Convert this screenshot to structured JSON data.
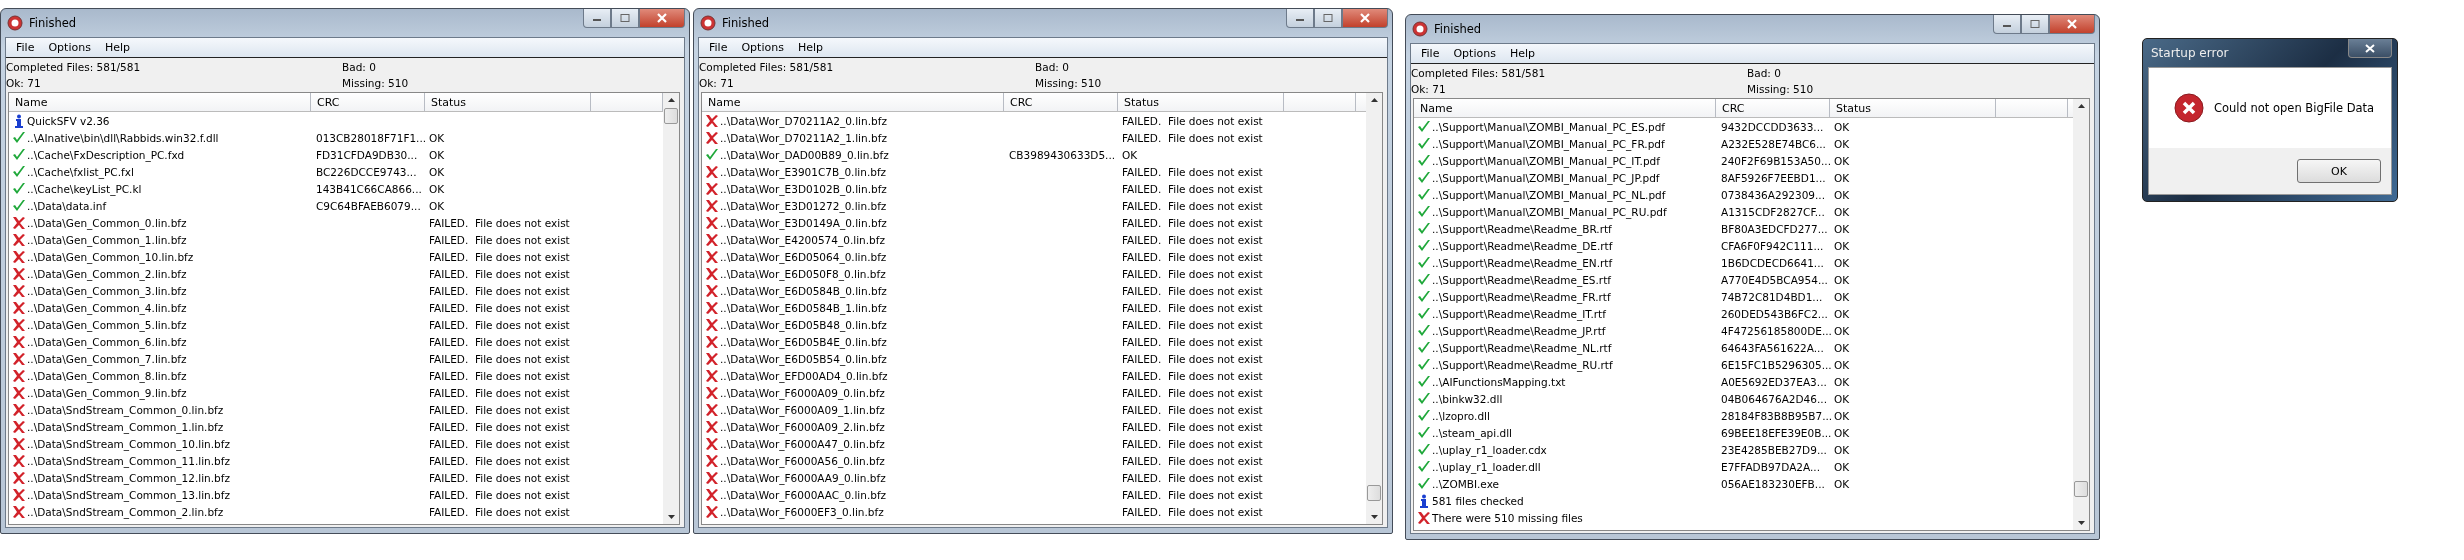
{
  "windows": [
    {
      "title": "Finished",
      "menu": [
        "File",
        "Options",
        "Help"
      ],
      "stats": {
        "completed": "Completed Files: 581/581",
        "bad": "Bad: 0",
        "ok": "Ok: 71",
        "missing": "Missing: 510"
      },
      "columns": [
        "Name",
        "CRC",
        "Status"
      ],
      "rows": [
        {
          "kind": "info",
          "name": "QuickSFV v2.36"
        },
        {
          "kind": "ok",
          "name": "..\\AInative\\bin\\dll\\Rabbids.win32.f.dll",
          "crc": "013CB28018F71F1...",
          "status": "OK"
        },
        {
          "kind": "ok",
          "name": "..\\Cache\\FxDescription_PC.fxd",
          "crc": "FD31CFDA9DB30...",
          "status": "OK"
        },
        {
          "kind": "ok",
          "name": "..\\Cache\\fxlist_PC.fxl",
          "crc": "BC226DCCE9743...",
          "status": "OK"
        },
        {
          "kind": "ok",
          "name": "..\\Cache\\keyList_PC.kl",
          "crc": "143B41C66CA866...",
          "status": "OK"
        },
        {
          "kind": "ok",
          "name": "..\\Data\\data.inf",
          "crc": "C9C64BFAEB6079...",
          "status": "OK"
        },
        {
          "kind": "failed",
          "name": "..\\Data\\Gen_Common_0.lin.bfz",
          "status": "FAILED.  File does not exist"
        },
        {
          "kind": "failed",
          "name": "..\\Data\\Gen_Common_1.lin.bfz",
          "status": "FAILED.  File does not exist"
        },
        {
          "kind": "failed",
          "name": "..\\Data\\Gen_Common_10.lin.bfz",
          "status": "FAILED.  File does not exist"
        },
        {
          "kind": "failed",
          "name": "..\\Data\\Gen_Common_2.lin.bfz",
          "status": "FAILED.  File does not exist"
        },
        {
          "kind": "failed",
          "name": "..\\Data\\Gen_Common_3.lin.bfz",
          "status": "FAILED.  File does not exist"
        },
        {
          "kind": "failed",
          "name": "..\\Data\\Gen_Common_4.lin.bfz",
          "status": "FAILED.  File does not exist"
        },
        {
          "kind": "failed",
          "name": "..\\Data\\Gen_Common_5.lin.bfz",
          "status": "FAILED.  File does not exist"
        },
        {
          "kind": "failed",
          "name": "..\\Data\\Gen_Common_6.lin.bfz",
          "status": "FAILED.  File does not exist"
        },
        {
          "kind": "failed",
          "name": "..\\Data\\Gen_Common_7.lin.bfz",
          "status": "FAILED.  File does not exist"
        },
        {
          "kind": "failed",
          "name": "..\\Data\\Gen_Common_8.lin.bfz",
          "status": "FAILED.  File does not exist"
        },
        {
          "kind": "failed",
          "name": "..\\Data\\Gen_Common_9.lin.bfz",
          "status": "FAILED.  File does not exist"
        },
        {
          "kind": "failed",
          "name": "..\\Data\\SndStream_Common_0.lin.bfz",
          "status": "FAILED.  File does not exist"
        },
        {
          "kind": "failed",
          "name": "..\\Data\\SndStream_Common_1.lin.bfz",
          "status": "FAILED.  File does not exist"
        },
        {
          "kind": "failed",
          "name": "..\\Data\\SndStream_Common_10.lin.bfz",
          "status": "FAILED.  File does not exist"
        },
        {
          "kind": "failed",
          "name": "..\\Data\\SndStream_Common_11.lin.bfz",
          "status": "FAILED.  File does not exist"
        },
        {
          "kind": "failed",
          "name": "..\\Data\\SndStream_Common_12.lin.bfz",
          "status": "FAILED.  File does not exist"
        },
        {
          "kind": "failed",
          "name": "..\\Data\\SndStream_Common_13.lin.bfz",
          "status": "FAILED.  File does not exist"
        },
        {
          "kind": "failed",
          "name": "..\\Data\\SndStream_Common_2.lin.bfz",
          "status": "FAILED.  File does not exist"
        }
      ]
    },
    {
      "title": "Finished",
      "menu": [
        "File",
        "Options",
        "Help"
      ],
      "stats": {
        "completed": "Completed Files: 581/581",
        "bad": "Bad: 0",
        "ok": "Ok: 71",
        "missing": "Missing: 510"
      },
      "columns": [
        "Name",
        "CRC",
        "Status"
      ],
      "rows": [
        {
          "kind": "failed",
          "name": "..\\Data\\Wor_D70211A2_0.lin.bfz",
          "status": "FAILED.  File does not exist"
        },
        {
          "kind": "failed",
          "name": "..\\Data\\Wor_D70211A2_1.lin.bfz",
          "status": "FAILED.  File does not exist"
        },
        {
          "kind": "ok",
          "name": "..\\Data\\Wor_DAD00B89_0.lin.bfz",
          "crc": "CB3989430633D5...",
          "status": "OK"
        },
        {
          "kind": "failed",
          "name": "..\\Data\\Wor_E3901C7B_0.lin.bfz",
          "status": "FAILED.  File does not exist"
        },
        {
          "kind": "failed",
          "name": "..\\Data\\Wor_E3D0102B_0.lin.bfz",
          "status": "FAILED.  File does not exist"
        },
        {
          "kind": "failed",
          "name": "..\\Data\\Wor_E3D01272_0.lin.bfz",
          "status": "FAILED.  File does not exist"
        },
        {
          "kind": "failed",
          "name": "..\\Data\\Wor_E3D0149A_0.lin.bfz",
          "status": "FAILED.  File does not exist"
        },
        {
          "kind": "failed",
          "name": "..\\Data\\Wor_E4200574_0.lin.bfz",
          "status": "FAILED.  File does not exist"
        },
        {
          "kind": "failed",
          "name": "..\\Data\\Wor_E6D05064_0.lin.bfz",
          "status": "FAILED.  File does not exist"
        },
        {
          "kind": "failed",
          "name": "..\\Data\\Wor_E6D050F8_0.lin.bfz",
          "status": "FAILED.  File does not exist"
        },
        {
          "kind": "failed",
          "name": "..\\Data\\Wor_E6D0584B_0.lin.bfz",
          "status": "FAILED.  File does not exist"
        },
        {
          "kind": "failed",
          "name": "..\\Data\\Wor_E6D0584B_1.lin.bfz",
          "status": "FAILED.  File does not exist"
        },
        {
          "kind": "failed",
          "name": "..\\Data\\Wor_E6D05B48_0.lin.bfz",
          "status": "FAILED.  File does not exist"
        },
        {
          "kind": "failed",
          "name": "..\\Data\\Wor_E6D05B4E_0.lin.bfz",
          "status": "FAILED.  File does not exist"
        },
        {
          "kind": "failed",
          "name": "..\\Data\\Wor_E6D05B54_0.lin.bfz",
          "status": "FAILED.  File does not exist"
        },
        {
          "kind": "failed",
          "name": "..\\Data\\Wor_EFD00AD4_0.lin.bfz",
          "status": "FAILED.  File does not exist"
        },
        {
          "kind": "failed",
          "name": "..\\Data\\Wor_F6000A09_0.lin.bfz",
          "status": "FAILED.  File does not exist"
        },
        {
          "kind": "failed",
          "name": "..\\Data\\Wor_F6000A09_1.lin.bfz",
          "status": "FAILED.  File does not exist"
        },
        {
          "kind": "failed",
          "name": "..\\Data\\Wor_F6000A09_2.lin.bfz",
          "status": "FAILED.  File does not exist"
        },
        {
          "kind": "failed",
          "name": "..\\Data\\Wor_F6000A47_0.lin.bfz",
          "status": "FAILED.  File does not exist"
        },
        {
          "kind": "failed",
          "name": "..\\Data\\Wor_F6000A56_0.lin.bfz",
          "status": "FAILED.  File does not exist"
        },
        {
          "kind": "failed",
          "name": "..\\Data\\Wor_F6000AA9_0.lin.bfz",
          "status": "FAILED.  File does not exist"
        },
        {
          "kind": "failed",
          "name": "..\\Data\\Wor_F6000AAC_0.lin.bfz",
          "status": "FAILED.  File does not exist"
        },
        {
          "kind": "failed",
          "name": "..\\Data\\Wor_F6000EF3_0.lin.bfz",
          "status": "FAILED.  File does not exist"
        }
      ]
    },
    {
      "title": "Finished",
      "menu": [
        "File",
        "Options",
        "Help"
      ],
      "stats": {
        "completed": "Completed Files: 581/581",
        "bad": "Bad: 0",
        "ok": "Ok: 71",
        "missing": "Missing: 510"
      },
      "columns": [
        "Name",
        "CRC",
        "Status"
      ],
      "rows": [
        {
          "kind": "ok",
          "name": "..\\Support\\Manual\\ZOMBI_Manual_PC_ES.pdf",
          "crc": "9432DCCDD3633...",
          "status": "OK"
        },
        {
          "kind": "ok",
          "name": "..\\Support\\Manual\\ZOMBI_Manual_PC_FR.pdf",
          "crc": "A232E528E74BC6...",
          "status": "OK"
        },
        {
          "kind": "ok",
          "name": "..\\Support\\Manual\\ZOMBI_Manual_PC_IT.pdf",
          "crc": "240F2F69B153A50...",
          "status": "OK"
        },
        {
          "kind": "ok",
          "name": "..\\Support\\Manual\\ZOMBI_Manual_PC_JP.pdf",
          "crc": "8AF5926F7EEBD1...",
          "status": "OK"
        },
        {
          "kind": "ok",
          "name": "..\\Support\\Manual\\ZOMBI_Manual_PC_NL.pdf",
          "crc": "0738436A292309...",
          "status": "OK"
        },
        {
          "kind": "ok",
          "name": "..\\Support\\Manual\\ZOMBI_Manual_PC_RU.pdf",
          "crc": "A1315CDF2827CF...",
          "status": "OK"
        },
        {
          "kind": "ok",
          "name": "..\\Support\\Readme\\Readme_BR.rtf",
          "crc": "BF80A3EDCFD277...",
          "status": "OK"
        },
        {
          "kind": "ok",
          "name": "..\\Support\\Readme\\Readme_DE.rtf",
          "crc": "CFA6F0F942C111...",
          "status": "OK"
        },
        {
          "kind": "ok",
          "name": "..\\Support\\Readme\\Readme_EN.rtf",
          "crc": "1B6DCDECD6641...",
          "status": "OK"
        },
        {
          "kind": "ok",
          "name": "..\\Support\\Readme\\Readme_ES.rtf",
          "crc": "A770E4D5BCA954...",
          "status": "OK"
        },
        {
          "kind": "ok",
          "name": "..\\Support\\Readme\\Readme_FR.rtf",
          "crc": "74B72C81D4BD1...",
          "status": "OK"
        },
        {
          "kind": "ok",
          "name": "..\\Support\\Readme\\Readme_IT.rtf",
          "crc": "260DED543B6FC2...",
          "status": "OK"
        },
        {
          "kind": "ok",
          "name": "..\\Support\\Readme\\Readme_JP.rtf",
          "crc": "4F47256185800DE...",
          "status": "OK"
        },
        {
          "kind": "ok",
          "name": "..\\Support\\Readme\\Readme_NL.rtf",
          "crc": "64643FA561622A...",
          "status": "OK"
        },
        {
          "kind": "ok",
          "name": "..\\Support\\Readme\\Readme_RU.rtf",
          "crc": "6E15FC1B5296305...",
          "status": "OK"
        },
        {
          "kind": "ok",
          "name": "..\\AIFunctionsMapping.txt",
          "crc": "A0E5692ED37EA3...",
          "status": "OK"
        },
        {
          "kind": "ok",
          "name": "..\\binkw32.dll",
          "crc": "04B064676A2D46...",
          "status": "OK"
        },
        {
          "kind": "ok",
          "name": "..\\lzopro.dll",
          "crc": "28184F83B8B95B7...",
          "status": "OK"
        },
        {
          "kind": "ok",
          "name": "..\\steam_api.dll",
          "crc": "69BEE18EFE39E0B...",
          "status": "OK"
        },
        {
          "kind": "ok",
          "name": "..\\uplay_r1_loader.cdx",
          "crc": "23E4285BEB27D9...",
          "status": "OK"
        },
        {
          "kind": "ok",
          "name": "..\\uplay_r1_loader.dll",
          "crc": "E7FFADB97DA2A...",
          "status": "OK"
        },
        {
          "kind": "ok",
          "name": "..\\ZOMBI.exe",
          "crc": "056AE183230EFB...",
          "status": "OK"
        },
        {
          "kind": "info",
          "name": "581 files checked"
        },
        {
          "kind": "failed",
          "name": "There were 510 missing files"
        }
      ]
    }
  ],
  "dialog": {
    "title": "Startup error",
    "message": "Could not open BigFile Data",
    "button": "OK"
  }
}
